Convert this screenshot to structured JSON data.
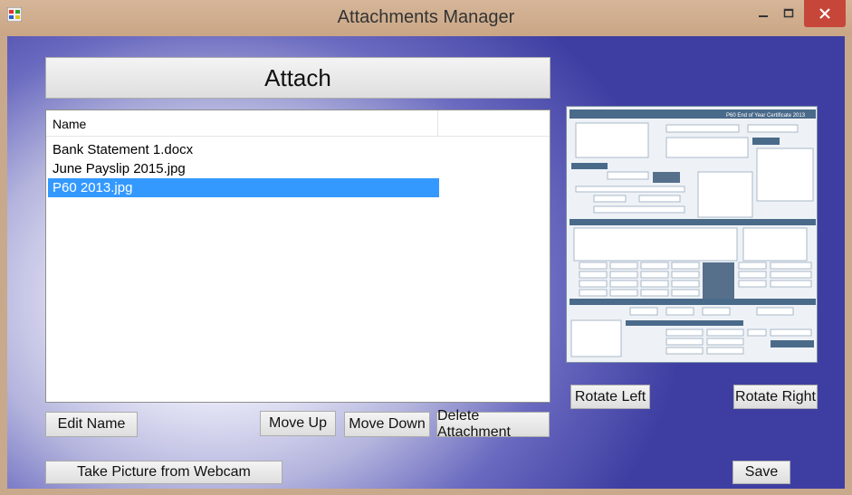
{
  "window": {
    "title": "Attachments Manager"
  },
  "attach_button": "Attach",
  "list": {
    "column_header": "Name",
    "items": [
      {
        "label": "Bank Statement 1.docx",
        "selected": false
      },
      {
        "label": "June Payslip 2015.jpg",
        "selected": false
      },
      {
        "label": "P60 2013.jpg",
        "selected": true
      }
    ]
  },
  "preview": {
    "form_title": "P60 End of Year Certificate 2013"
  },
  "buttons": {
    "rotate_left": "Rotate Left",
    "rotate_right": "Rotate Right",
    "edit_name": "Edit Name",
    "move_up": "Move Up",
    "move_down": "Move Down",
    "delete_attachment": "Delete Attachment",
    "take_picture": "Take Picture from Webcam",
    "save": "Save"
  },
  "colors": {
    "selection": "#3399ff",
    "close_button": "#c7463a",
    "titlebar": "#ccab8c"
  }
}
